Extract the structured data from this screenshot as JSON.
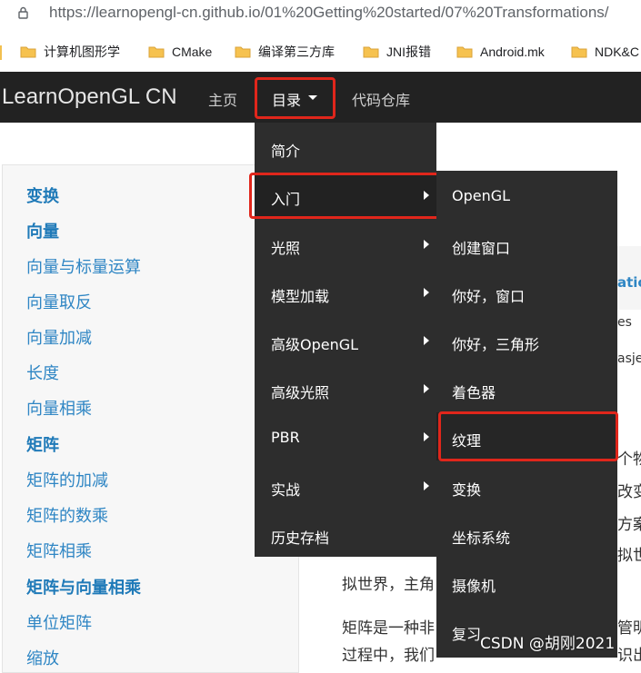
{
  "browser": {
    "url": "https://learnopengl-cn.github.io/01%20Getting%20started/07%20Transformations/"
  },
  "bookmarks": [
    {
      "label": "计算机图形学",
      "icon": "folder-icon"
    },
    {
      "label": "CMake",
      "icon": "folder-icon"
    },
    {
      "label": "编译第三方库",
      "icon": "folder-icon"
    },
    {
      "label": "JNI报错",
      "icon": "folder-icon"
    },
    {
      "label": "Android.mk",
      "icon": "folder-icon"
    },
    {
      "label": "NDK&C",
      "icon": "folder-icon"
    }
  ],
  "navbar": {
    "brand": "LearnOpenGL CN",
    "home": "主页",
    "directory": "目录",
    "repo": "代码仓库",
    "background": "#222222"
  },
  "sidebar": {
    "items": [
      {
        "label": "变换",
        "bold": true
      },
      {
        "label": "向量",
        "bold": true
      },
      {
        "label": "向量与标量运算",
        "bold": false
      },
      {
        "label": "向量取反",
        "bold": false
      },
      {
        "label": "向量加减",
        "bold": false
      },
      {
        "label": "长度",
        "bold": false
      },
      {
        "label": "向量相乘",
        "bold": false
      },
      {
        "label": "矩阵",
        "bold": true
      },
      {
        "label": "矩阵的加减",
        "bold": false
      },
      {
        "label": "矩阵的数乘",
        "bold": false
      },
      {
        "label": "矩阵相乘",
        "bold": false
      },
      {
        "label": "矩阵与向量相乘",
        "bold": true
      },
      {
        "label": "单位矩阵",
        "bold": false
      },
      {
        "label": "缩放",
        "bold": false
      }
    ]
  },
  "menu": {
    "items": [
      {
        "label": "简介",
        "submenu": false
      },
      {
        "label": "入门",
        "submenu": true,
        "highlighted": true
      },
      {
        "label": "光照",
        "submenu": true
      },
      {
        "label": "模型加载",
        "submenu": true
      },
      {
        "label": "高级OpenGL",
        "submenu": true
      },
      {
        "label": "高级光照",
        "submenu": true
      },
      {
        "label": "PBR",
        "submenu": true
      },
      {
        "label": "实战",
        "submenu": true
      },
      {
        "label": "历史存档",
        "submenu": false
      }
    ]
  },
  "submenu": {
    "items": [
      {
        "label": "OpenGL"
      },
      {
        "label": "创建窗口"
      },
      {
        "label": "你好，窗口"
      },
      {
        "label": "你好，三角形"
      },
      {
        "label": "着色器"
      },
      {
        "label": "纹理",
        "highlighted": true
      },
      {
        "label": "变换",
        "active": true
      },
      {
        "label": "坐标系统"
      },
      {
        "label": "摄像机"
      },
      {
        "label": "复习"
      }
    ]
  },
  "content_peek": {
    "line1": "atic",
    "line2": "es",
    "line3": "asje",
    "line4": "个物",
    "line5": "改变",
    "line6": "方案",
    "line7": "拟世",
    "line8": "拟世界，主角",
    "line9": "矩阵是一种非",
    "line9b": "管明",
    "line10": "过程中，我们",
    "line10b": "识出"
  },
  "watermark": "CSDN @胡刚2021",
  "colors": {
    "accent_red": "#e0261b",
    "link_blue": "#2f86c4",
    "menu_bg": "#2d2d2d"
  }
}
